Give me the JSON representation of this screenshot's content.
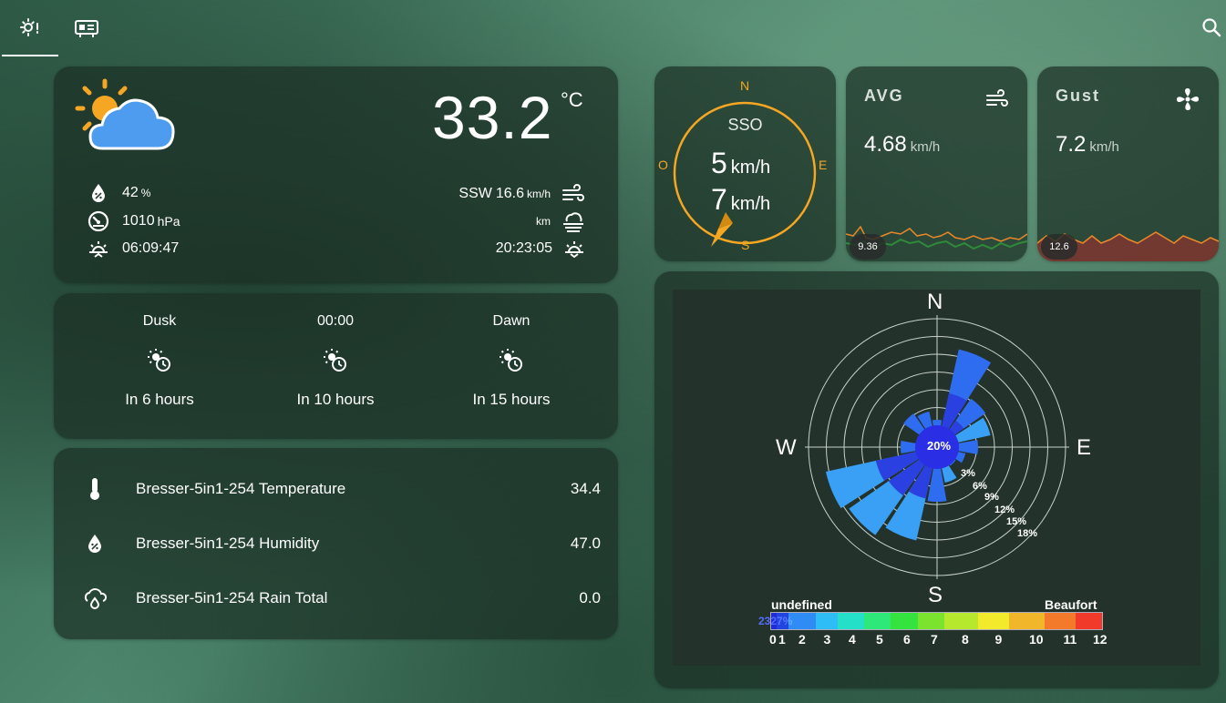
{
  "weather": {
    "temperature": "33.2",
    "temp_unit": "°C",
    "humidity": "42",
    "humidity_unit": "%",
    "pressure": "1010",
    "pressure_unit": "hPa",
    "sunrise": "06:09:47",
    "wind_dir": "SSW",
    "wind_speed": "16.6",
    "wind_unit": "km/h",
    "visibility_unit": "km",
    "sunset": "20:23:05"
  },
  "sun_events": [
    {
      "label": "Dusk",
      "relative": "In 6 hours"
    },
    {
      "label": "00:00",
      "relative": "In 10 hours"
    },
    {
      "label": "Dawn",
      "relative": "In 15 hours"
    }
  ],
  "sensors": [
    {
      "name": "Bresser-5in1-254 Temperature",
      "value": "34.4",
      "icon": "thermometer-icon"
    },
    {
      "name": "Bresser-5in1-254 Humidity",
      "value": "47.0",
      "icon": "humidity-icon"
    },
    {
      "name": "Bresser-5in1-254 Rain Total",
      "value": "0.0",
      "icon": "rain-icon"
    }
  ],
  "compass": {
    "n": "N",
    "e": "E",
    "s": "S",
    "o": "O",
    "direction": "SSO",
    "speed1": "5",
    "speed2": "7",
    "unit": "km/h",
    "color": "#f5a623"
  },
  "avg": {
    "title": "AVG",
    "value": "4.68",
    "unit": "km/h",
    "max": "9.36"
  },
  "gust": {
    "title": "Gust",
    "value": "7.2",
    "unit": "km/h",
    "max": "12.6"
  },
  "windrose": {
    "dirs": {
      "n": "N",
      "e": "E",
      "s": "S",
      "w": "W"
    },
    "center": "20%",
    "rings": [
      "3%",
      "6%",
      "9%",
      "12%",
      "15%",
      "18%"
    ],
    "legend_left": "undefined",
    "legend_right": "Beaufort",
    "legend_overlap": "2327%",
    "scale": [
      "0",
      "1",
      "2",
      "3",
      "4",
      "5",
      "6",
      "7",
      "8",
      "9",
      "10",
      "11",
      "12"
    ],
    "colors": [
      "#1f2bd6",
      "#2244e0",
      "#2f8cf5",
      "#2fbdf5",
      "#24e0c8",
      "#2ee87a",
      "#35e33f",
      "#7be32e",
      "#b6e82e",
      "#f2ea2a",
      "#f2b62a",
      "#f27a2a",
      "#f23a2a"
    ]
  }
}
